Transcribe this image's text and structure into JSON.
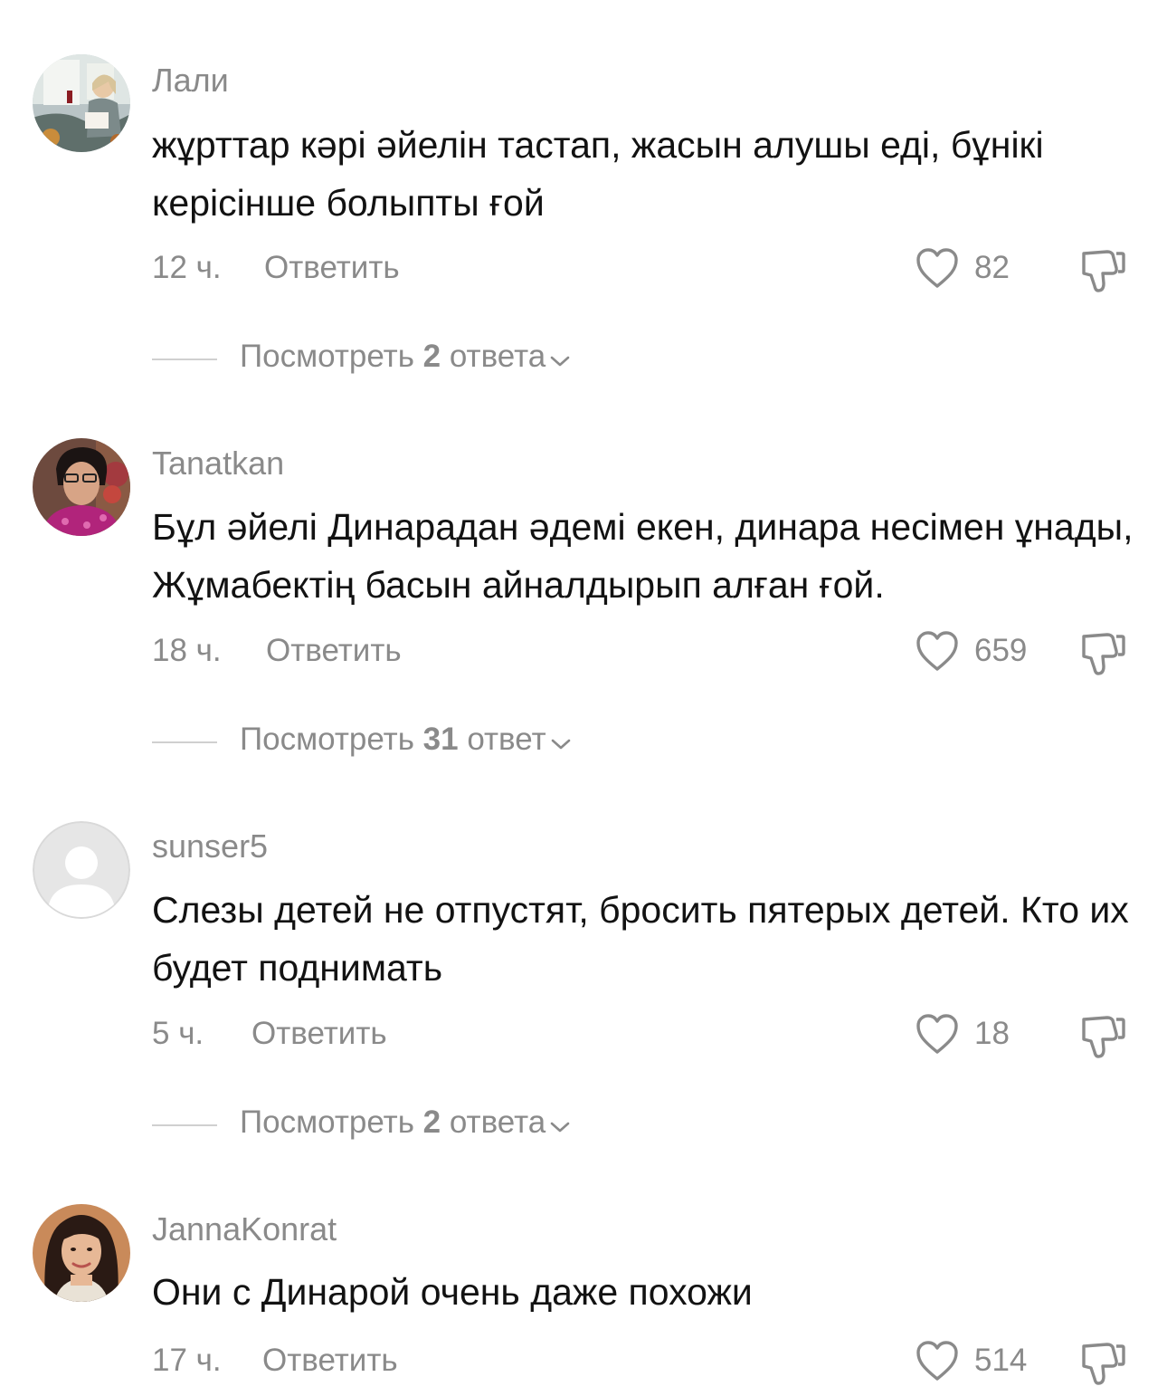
{
  "comments": [
    {
      "username": "Лали",
      "text": "жұрттар кәрі әйелін тастап, жасын алушы еді, бұнікі керісінше болыпты ғой",
      "time": "12 ч.",
      "reply_label": "Ответить",
      "likes": "82",
      "view_replies": {
        "prefix": "Посмотреть ",
        "count": "2",
        "suffix": " ответа"
      }
    },
    {
      "username": "Tanatkan",
      "text": "Бұл әйелі Динарадан әдемі екен, динара несімен ұнады, Жұмабектің басын айналдырып алған ғой.",
      "time": "18 ч.",
      "reply_label": "Ответить",
      "likes": "659",
      "view_replies": {
        "prefix": "Посмотреть ",
        "count": "31",
        "suffix": " ответ"
      }
    },
    {
      "username": "sunser5",
      "text": "Слезы детей не отпустят, бросить пятерых детей. Кто их будет поднимать",
      "time": "5 ч.",
      "reply_label": "Ответить",
      "likes": "18",
      "view_replies": {
        "prefix": "Посмотреть ",
        "count": "2",
        "suffix": " ответа"
      }
    },
    {
      "username": "JannaKonrat",
      "text": "Они с Динарой очень даже похожи",
      "time": "17 ч.",
      "reply_label": "Ответить",
      "likes": "514"
    }
  ],
  "icons": {
    "like": "heart-outline-icon",
    "dislike": "thumbs-down-outline-icon",
    "expand": "chevron-down-icon",
    "default_avatar": "default-user-avatar-icon"
  },
  "colors": {
    "text": "#121212",
    "secondary": "#8a8a8a",
    "divider": "#d0d0d0"
  }
}
